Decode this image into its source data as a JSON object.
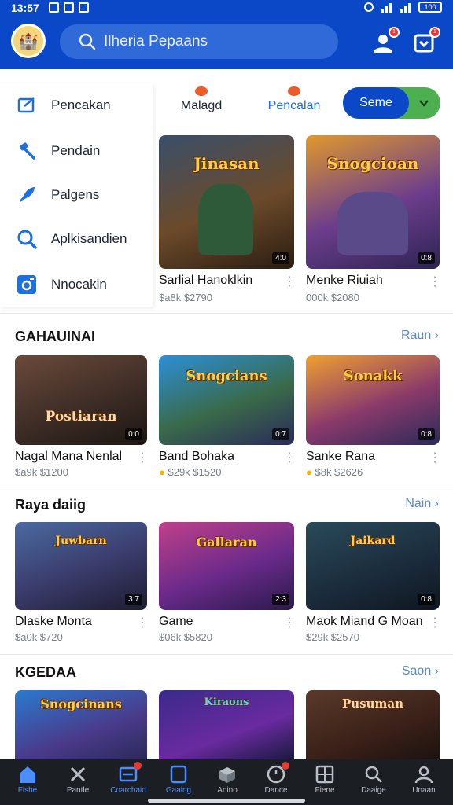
{
  "status_bar": {
    "time": "13:57",
    "battery": "100"
  },
  "header": {
    "search_placeholder": "Ilheria Pepaans",
    "profile_badge": "1",
    "notifications_badge": "1"
  },
  "drawer": {
    "items": [
      {
        "label": "Pencakan",
        "icon": "edit-box-icon"
      },
      {
        "label": "Pendain",
        "icon": "hammer-icon"
      },
      {
        "label": "Palgens",
        "icon": "rocket-icon"
      },
      {
        "label": "Aplkisandien",
        "icon": "search-icon"
      },
      {
        "label": "Nnocakin",
        "icon": "camera-icon"
      }
    ]
  },
  "tabs": [
    {
      "label": "Malagd"
    },
    {
      "label": "Pencalan"
    }
  ],
  "toggle": {
    "label": "Seme"
  },
  "featured": [
    {
      "title": "Sarlial Hanoklkin",
      "meta": "$a8k  $2790",
      "art": "Jinasan",
      "corner": "4:0"
    },
    {
      "title": "Menke Riuiah",
      "meta": "000k  $2080",
      "art": "Snogcioan",
      "corner": "0:8"
    }
  ],
  "sections": [
    {
      "title": "GAHAUINAI",
      "more": "Raun",
      "cards": [
        {
          "title": "Nagal Mana Nenlal",
          "meta": "$a9k  $1200",
          "art": "Postiaran",
          "corner": "0:0"
        },
        {
          "title": "Band Bohaka",
          "meta": "$29k  $1520",
          "art": "Snogcians",
          "corner": "0:7",
          "rated": true
        },
        {
          "title": "Sanke Rana",
          "meta": "$8k  $2626",
          "art": "Sonakk",
          "corner": "0:8",
          "rated": true
        }
      ]
    },
    {
      "title": "Raya daiig",
      "more": "Nain",
      "cards": [
        {
          "title": "Dlaske Monta",
          "meta": "$a0k  $720",
          "art": "Juwbarn",
          "corner": "3:7"
        },
        {
          "title": "Game",
          "meta": "$06k  $5820",
          "art": "Gallaran",
          "corner": "2:3"
        },
        {
          "title": "Maok Miand G Moan",
          "meta": "$29k  $2570",
          "art": "Jaikard",
          "corner": "0:8"
        }
      ]
    },
    {
      "title": "KGEDAA",
      "more": "Saon",
      "cards": [
        {
          "title": "",
          "meta": "",
          "art": "Snogcinans",
          "corner": ""
        },
        {
          "title": "",
          "meta": "",
          "art": "Kiraons",
          "corner": ""
        },
        {
          "title": "",
          "meta": "",
          "art": "Pusuman",
          "corner": ""
        }
      ]
    }
  ],
  "bottom_nav": [
    {
      "label": "Fishe",
      "icon": "home-icon",
      "active": true
    },
    {
      "label": "Pantle",
      "icon": "tools-icon"
    },
    {
      "label": "Coarchaid",
      "icon": "cart-icon",
      "active": true,
      "badge": true
    },
    {
      "label": "Gaaing",
      "icon": "document-icon",
      "active": true
    },
    {
      "label": "Anino",
      "icon": "box-icon"
    },
    {
      "label": "Dance",
      "icon": "clock-icon",
      "badge": true
    },
    {
      "label": "Fiene",
      "icon": "grid-icon"
    },
    {
      "label": "Daaige",
      "icon": "search-icon"
    },
    {
      "label": "Unaan",
      "icon": "user-icon"
    }
  ],
  "colors": {
    "brand": "#0a48c8",
    "accent": "#4caf50",
    "nav_bg": "#1b1f24",
    "link": "#5b87c8"
  }
}
